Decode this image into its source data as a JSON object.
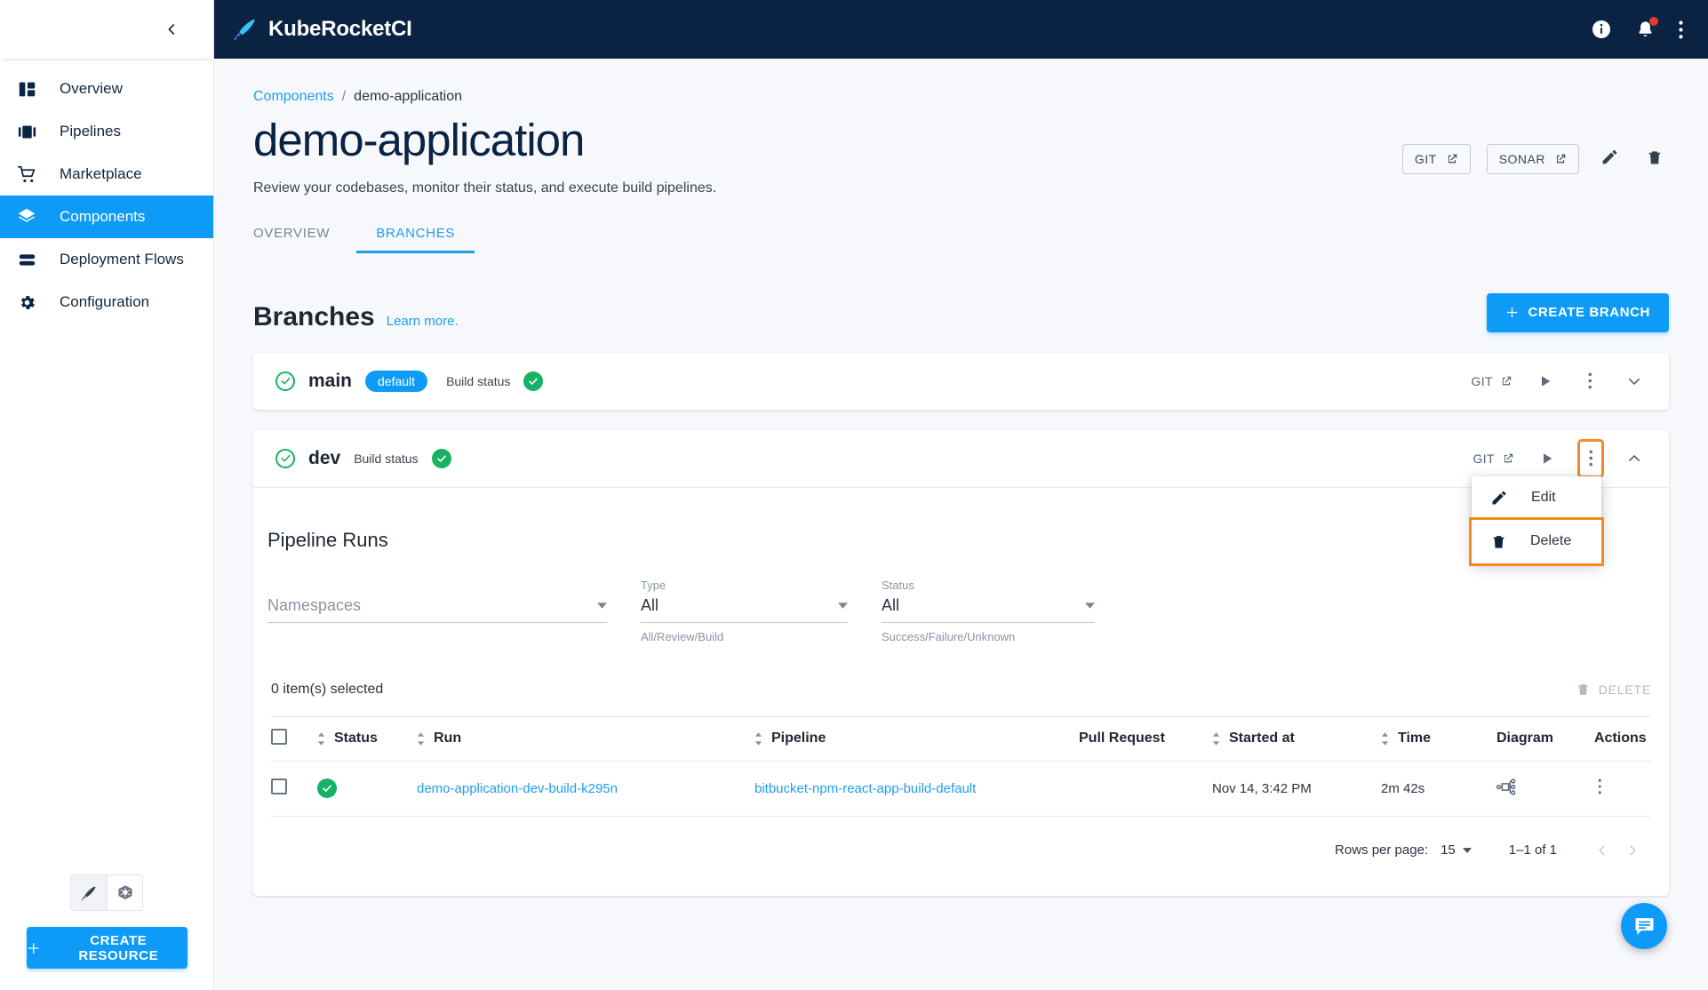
{
  "sidebar": {
    "collapse_icon": "chevron-left-icon",
    "items": [
      {
        "label": "Overview",
        "icon": "dashboard-icon",
        "active": false
      },
      {
        "label": "Pipelines",
        "icon": "pipelines-icon",
        "active": false
      },
      {
        "label": "Marketplace",
        "icon": "cart-icon",
        "active": false
      },
      {
        "label": "Components",
        "icon": "layers-icon",
        "active": true
      },
      {
        "label": "Deployment Flows",
        "icon": "stack-icon",
        "active": false
      },
      {
        "label": "Configuration",
        "icon": "gear-icon",
        "active": false
      }
    ],
    "cluster_switch": [
      {
        "icon": "kuberocket-logo-icon",
        "selected": true
      },
      {
        "icon": "kubernetes-logo-icon",
        "selected": false
      }
    ],
    "create_resource_label": "CREATE RESOURCE"
  },
  "topbar": {
    "brand": "KubeRocketCI",
    "logo_icon": "kuberocket-rocket-icon",
    "actions": [
      {
        "icon": "info-icon",
        "badge": false
      },
      {
        "icon": "bell-icon",
        "badge": true
      },
      {
        "icon": "more-vertical-icon",
        "badge": false
      }
    ]
  },
  "page": {
    "breadcrumb": {
      "parent": "Components",
      "separator": "/",
      "current": "demo-application"
    },
    "title": "demo-application",
    "subtitle": "Review your codebases, monitor their status, and execute build pipelines.",
    "header_actions": {
      "git_label": "GIT",
      "sonar_label": "SONAR",
      "edit_icon": "pencil-icon",
      "delete_icon": "trash-icon"
    },
    "tabs": [
      {
        "label": "OVERVIEW",
        "active": false
      },
      {
        "label": "BRANCHES",
        "active": true
      }
    ]
  },
  "branches_section": {
    "title": "Branches",
    "learn_more": "Learn more.",
    "create_button": "CREATE BRANCH",
    "build_status_label": "Build status",
    "git_label": "GIT",
    "items": [
      {
        "name": "main",
        "default_chip": "default",
        "status_icon": "check-circle-outline-icon",
        "build_status_icon": "check-circle-filled-icon",
        "expanded": false
      },
      {
        "name": "dev",
        "default_chip": null,
        "status_icon": "check-circle-outline-icon",
        "build_status_icon": "check-circle-filled-icon",
        "expanded": true
      }
    ]
  },
  "branch_menu": {
    "visible": true,
    "items": [
      {
        "label": "Edit",
        "icon": "pencil-icon",
        "highlighted": false
      },
      {
        "label": "Delete",
        "icon": "trash-icon",
        "highlighted": true
      }
    ]
  },
  "pipeline_runs": {
    "title": "Pipeline Runs",
    "filters": [
      {
        "label": "",
        "value": "Namespaces",
        "is_placeholder": true,
        "help": ""
      },
      {
        "label": "Type",
        "value": "All",
        "is_placeholder": false,
        "help": "All/Review/Build"
      },
      {
        "label": "Status",
        "value": "All",
        "is_placeholder": false,
        "help": "Success/Failure/Unknown"
      }
    ],
    "selection_text": "0 item(s) selected",
    "bulk_delete_label": "DELETE",
    "columns": [
      {
        "label": "",
        "sortable": false
      },
      {
        "label": "Status",
        "sortable": true
      },
      {
        "label": "Run",
        "sortable": true
      },
      {
        "label": "Pipeline",
        "sortable": true
      },
      {
        "label": "Pull Request",
        "sortable": false
      },
      {
        "label": "Started at",
        "sortable": true
      },
      {
        "label": "Time",
        "sortable": true
      },
      {
        "label": "Diagram",
        "sortable": false
      },
      {
        "label": "Actions",
        "sortable": false
      }
    ],
    "rows": [
      {
        "selected": false,
        "status_icon": "check-circle-filled-icon",
        "run": "demo-application-dev-build-k295n",
        "pipeline": "bitbucket-npm-react-app-build-default",
        "pull_request": "",
        "started_at": "Nov 14, 3:42 PM",
        "time": "2m 42s",
        "diagram_icon": "pipeline-diagram-icon",
        "actions_icon": "more-vertical-icon"
      }
    ],
    "pagination": {
      "rows_per_page_label": "Rows per page:",
      "rows_per_page_value": "15",
      "range_label": "1–1 of 1",
      "prev_icon": "chevron-left-icon",
      "next_icon": "chevron-right-icon"
    }
  },
  "chat_fab": {
    "icon": "chat-icon"
  },
  "colors": {
    "brand_navy": "#0a2342",
    "accent_blue": "#0e9bf7",
    "link_blue": "#1f9cf0",
    "success_green": "#16b364",
    "highlight_orange": "#f28b20",
    "page_bg": "#f7f8fc"
  }
}
